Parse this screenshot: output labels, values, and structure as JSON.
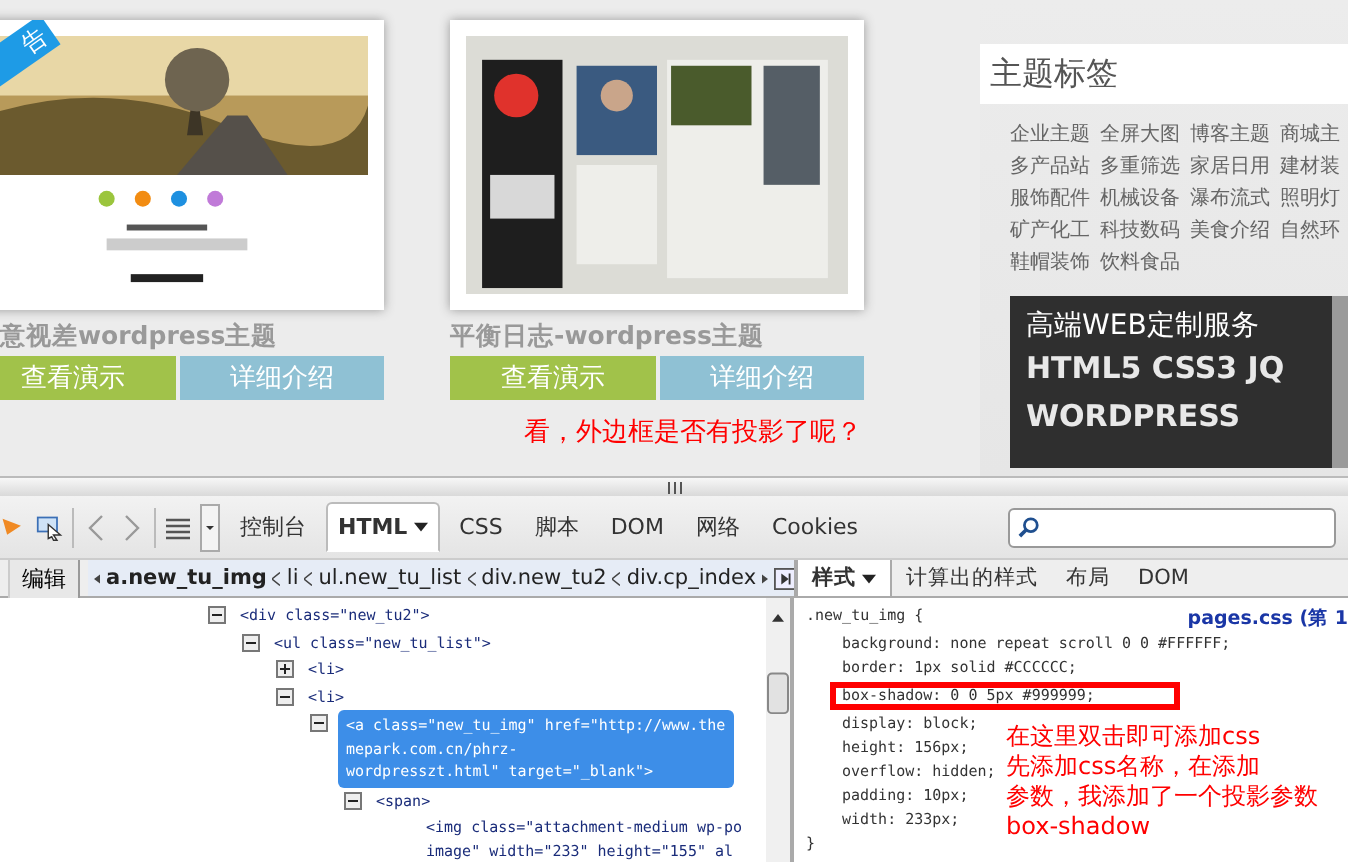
{
  "page": {
    "ribbon": "告",
    "themes": [
      {
        "title": "意视差wordpress主题",
        "buttons": [
          "查看演示",
          "详细介绍"
        ],
        "kind": "landscape"
      },
      {
        "title": "平衡日志-wordpress主题",
        "buttons": [
          "查看演示",
          "详细介绍"
        ],
        "kind": "blog"
      }
    ],
    "note": "看，外边框是否有投影了呢？",
    "tags_panel": {
      "heading": "主题标签",
      "tags": [
        "企业主题",
        "全屏大图",
        "博客主题",
        "商城主",
        "多产品站",
        "多重筛选",
        "家居日用",
        "建材装",
        "服饰配件",
        "机械设备",
        "瀑布流式",
        "照明灯",
        "矿产化工",
        "科技数码",
        "美食介绍",
        "自然环",
        "鞋帽装饰",
        "饮料食品"
      ]
    },
    "banner": {
      "lines": [
        "高端WEB定制服务",
        "HTML5 CSS3 JQ",
        "WORDPRESS"
      ]
    }
  },
  "devtools": {
    "tabs": [
      {
        "label": "控制台",
        "selected": false,
        "dropdown": false
      },
      {
        "label": "HTML",
        "selected": true,
        "dropdown": true
      },
      {
        "label": "CSS",
        "selected": false,
        "dropdown": false
      },
      {
        "label": "脚本",
        "selected": false,
        "dropdown": false
      },
      {
        "label": "DOM",
        "selected": false,
        "dropdown": false
      },
      {
        "label": "网络",
        "selected": false,
        "dropdown": false
      },
      {
        "label": "Cookies",
        "selected": false,
        "dropdown": false
      }
    ],
    "edit_button": "编辑",
    "breadcrumb": [
      {
        "label": "a.new_tu_img",
        "selected": true
      },
      {
        "label": "li",
        "selected": false
      },
      {
        "label": "ul.new_tu_list",
        "selected": false
      },
      {
        "label": "div.new_tu2",
        "selected": false
      },
      {
        "label": "div.cp_index",
        "selected": false
      }
    ],
    "side_tabs": [
      {
        "label": "样式",
        "selected": true,
        "dropdown": true
      },
      {
        "label": "计算出的样式",
        "selected": false,
        "dropdown": false
      },
      {
        "label": "布局",
        "selected": false,
        "dropdown": false
      },
      {
        "label": "DOM",
        "selected": false,
        "dropdown": false
      }
    ],
    "html_tree": [
      {
        "lines": [
          "<div class=\"new_tu2\">"
        ],
        "expanded": true,
        "selected": false,
        "children": [
          {
            "lines": [
              "<ul class=\"new_tu_list\">"
            ],
            "expanded": true,
            "selected": false,
            "children": [
              {
                "lines": [
                  "<li>"
                ],
                "expanded": false,
                "selected": false
              },
              {
                "lines": [
                  "<li>"
                ],
                "expanded": true,
                "selected": false,
                "children": [
                  {
                    "lines": [
                      "<a class=\"new_tu_img\" href=\"http://www.the",
                      "mepark.com.cn/phrz-",
                      "wordpresszt.html\" target=\"_blank\">"
                    ],
                    "expanded": true,
                    "selected": true,
                    "children": [
                      {
                        "lines": [
                          "<span>"
                        ],
                        "expanded": true,
                        "selected": false,
                        "children": [
                          {
                            "lines": [
                              "<img class=\"attachment-medium wp-po",
                              "image\" width=\"233\" height=\"155\" al"
                            ],
                            "selected": false
                          }
                        ]
                      }
                    ]
                  }
                ]
              }
            ]
          }
        ]
      }
    ],
    "style_rule": {
      "selector": ".new_tu_img {",
      "source": "pages.css (第 1",
      "close": "}",
      "properties": [
        {
          "text": "background: none repeat scroll 0 0 #FFFFFF;",
          "highlighted": false
        },
        {
          "text": "border: 1px solid #CCCCCC;",
          "highlighted": false
        },
        {
          "text": "box-shadow: 0 0 5px #999999;",
          "highlighted": true
        },
        {
          "text": "display: block;",
          "highlighted": false
        },
        {
          "text": "height: 156px;",
          "highlighted": false
        },
        {
          "text": "overflow: hidden;",
          "highlighted": false
        },
        {
          "text": "padding: 10px;",
          "highlighted": false
        },
        {
          "text": "width: 233px;",
          "highlighted": false
        }
      ]
    },
    "annotation": [
      "在这里双击即可添加css",
      "先添加css名称，在添加",
      "参数，我添加了一个投影参数",
      "box-shadow"
    ]
  }
}
